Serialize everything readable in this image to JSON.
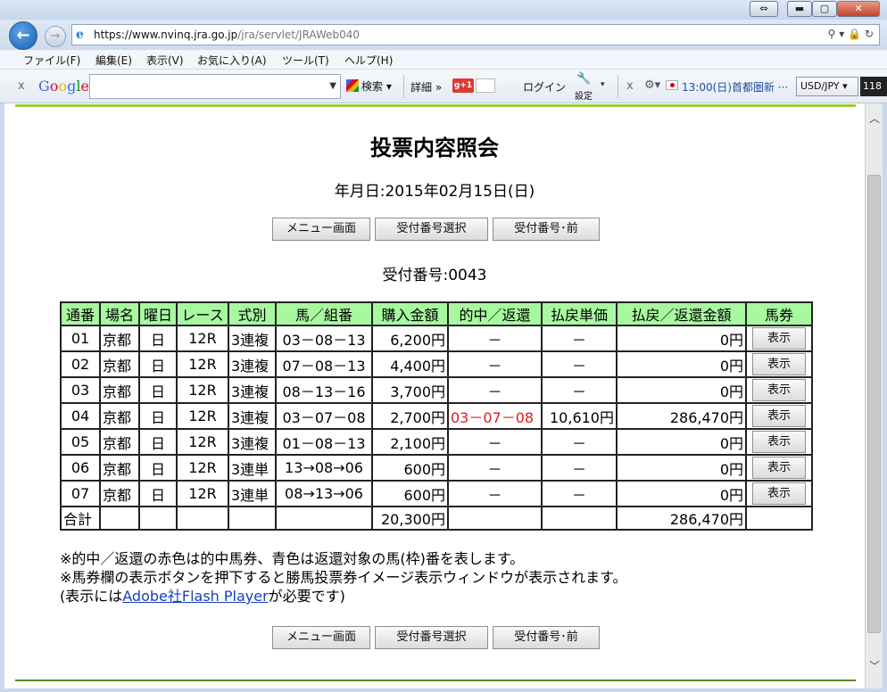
{
  "browser": {
    "url_host": "https://www.nvinq.jra.go.jp",
    "url_path": "/jra/servlet/JRAWeb040",
    "menu": [
      "ファイル(F)",
      "編集(E)",
      "表示(V)",
      "お気に入り(A)",
      "ツール(T)",
      "ヘルプ(H)"
    ],
    "toolbar": {
      "search_label": "検索",
      "details_label": "詳細 »",
      "gplus_label": "g+1",
      "login_label": "ログイン",
      "settings_label": "設定",
      "news": "13:00(日)首都圏新 ···",
      "currency_select": "USD/JPY",
      "currency_value": "118"
    }
  },
  "page": {
    "title": "投票内容照会",
    "date_line": "年月日:2015年02月15日(日)",
    "buttons": {
      "menu": "メニュー画面",
      "select_receipt": "受付番号選択",
      "prev_receipt": "受付番号･前"
    },
    "receipt_line": "受付番号:0043",
    "table": {
      "headers": [
        "通番",
        "場名",
        "曜日",
        "レース",
        "式別",
        "馬／組番",
        "購入金額",
        "的中／返還",
        "払戻単価",
        "払戻／返還金額",
        "馬券"
      ],
      "rows": [
        {
          "no": "01",
          "venue": "京都",
          "day": "日",
          "race": "12R",
          "type": "3連複",
          "combo": "03－08－13",
          "amount": "6,200円",
          "hit": "－",
          "unit": "－",
          "payout": "0円",
          "action": "表示"
        },
        {
          "no": "02",
          "venue": "京都",
          "day": "日",
          "race": "12R",
          "type": "3連複",
          "combo": "07－08－13",
          "amount": "4,400円",
          "hit": "－",
          "unit": "－",
          "payout": "0円",
          "action": "表示"
        },
        {
          "no": "03",
          "venue": "京都",
          "day": "日",
          "race": "12R",
          "type": "3連複",
          "combo": "08－13－16",
          "amount": "3,700円",
          "hit": "－",
          "unit": "－",
          "payout": "0円",
          "action": "表示"
        },
        {
          "no": "04",
          "venue": "京都",
          "day": "日",
          "race": "12R",
          "type": "3連複",
          "combo": "03－07－08",
          "amount": "2,700円",
          "hit": "03－07－08",
          "unit": "10,610円",
          "payout": "286,470円",
          "action": "表示"
        },
        {
          "no": "05",
          "venue": "京都",
          "day": "日",
          "race": "12R",
          "type": "3連複",
          "combo": "01－08－13",
          "amount": "2,100円",
          "hit": "－",
          "unit": "－",
          "payout": "0円",
          "action": "表示"
        },
        {
          "no": "06",
          "venue": "京都",
          "day": "日",
          "race": "12R",
          "type": "3連単",
          "combo": "13→08→06",
          "amount": "600円",
          "hit": "－",
          "unit": "－",
          "payout": "0円",
          "action": "表示"
        },
        {
          "no": "07",
          "venue": "京都",
          "day": "日",
          "race": "12R",
          "type": "3連単",
          "combo": "08→13→06",
          "amount": "600円",
          "hit": "－",
          "unit": "－",
          "payout": "0円",
          "action": "表示"
        }
      ],
      "total": {
        "label": "合計",
        "amount": "20,300円",
        "payout": "286,470円"
      }
    },
    "notes": {
      "line1": "※的中／返還の赤色は的中馬券、青色は返還対象の馬(枠)番を表します。",
      "line2": "※馬券欄の表示ボタンを押下すると勝馬投票券イメージ表示ウィンドウが表示されます。",
      "line3_pre": "(表示には",
      "line3_link": "Adobe社Flash Player",
      "line3_post": "が必要です)"
    },
    "colors": {
      "header_bg": "#a8f8a0",
      "hit_text": "#e01b1b",
      "accent_line": "#9acd32"
    }
  }
}
